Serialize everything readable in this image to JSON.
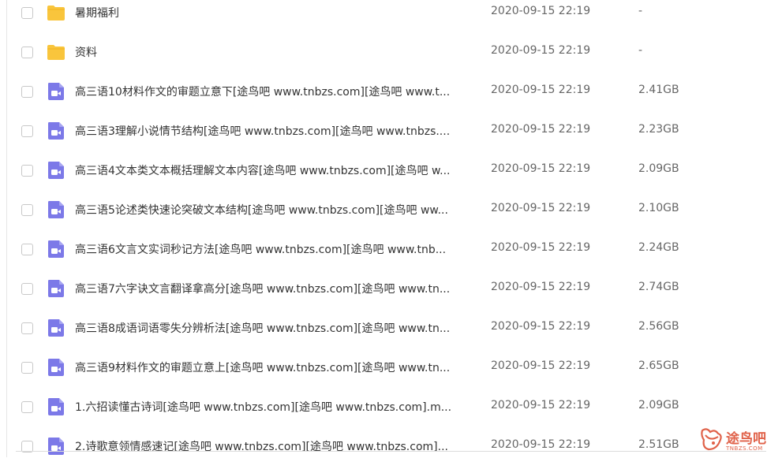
{
  "files": [
    {
      "name": "暑期福利",
      "date": "2020-09-15 22:19",
      "size": "-",
      "icon": "folder-icon",
      "type": "folder"
    },
    {
      "name": "资料",
      "date": "2020-09-15 22:19",
      "size": "-",
      "icon": "folder-icon",
      "type": "folder"
    },
    {
      "name": "高三语10材料作文的审题立意下[途鸟吧 www.tnbzs.com][途鸟吧 www.t...",
      "date": "2020-09-15 22:19",
      "size": "2.41GB",
      "icon": "video-file-icon",
      "type": "video"
    },
    {
      "name": "高三语3理解小说情节结构[途鸟吧 www.tnbzs.com][途鸟吧 www.tnbzs....",
      "date": "2020-09-15 22:19",
      "size": "2.23GB",
      "icon": "video-file-icon",
      "type": "video"
    },
    {
      "name": "高三语4文本类文本概括理解文本内容[途鸟吧 www.tnbzs.com][途鸟吧 w...",
      "date": "2020-09-15 22:19",
      "size": "2.09GB",
      "icon": "video-file-icon",
      "type": "video"
    },
    {
      "name": "高三语5论述类快速论突破文本结构[途鸟吧 www.tnbzs.com][途鸟吧 ww...",
      "date": "2020-09-15 22:19",
      "size": "2.10GB",
      "icon": "video-file-icon",
      "type": "video"
    },
    {
      "name": "高三语6文言文实词秒记方法[途鸟吧 www.tnbzs.com][途鸟吧 www.tnb...",
      "date": "2020-09-15 22:19",
      "size": "2.24GB",
      "icon": "video-file-icon",
      "type": "video"
    },
    {
      "name": "高三语7六字诀文言翻译拿高分[途鸟吧 www.tnbzs.com][途鸟吧 www.tn...",
      "date": "2020-09-15 22:19",
      "size": "2.74GB",
      "icon": "video-file-icon",
      "type": "video"
    },
    {
      "name": "高三语8成语词语零失分辨析法[途鸟吧 www.tnbzs.com][途鸟吧 www.tn...",
      "date": "2020-09-15 22:19",
      "size": "2.56GB",
      "icon": "video-file-icon",
      "type": "video"
    },
    {
      "name": "高三语9材料作文的审题立意上[途鸟吧 www.tnbzs.com][途鸟吧 www.tn...",
      "date": "2020-09-15 22:19",
      "size": "2.65GB",
      "icon": "video-file-icon",
      "type": "video"
    },
    {
      "name": "1.六招读懂古诗词[途鸟吧 www.tnbzs.com][途鸟吧 www.tnbzs.com].m...",
      "date": "2020-09-15 22:19",
      "size": "2.09GB",
      "icon": "video-file-icon",
      "type": "video"
    },
    {
      "name": "2.诗歌意领情感速记[途鸟吧 www.tnbzs.com][途鸟吧 www.tnbzs.com]...",
      "date": "2020-09-15 22:19",
      "size": "2.51GB",
      "icon": "video-file-icon",
      "type": "video"
    }
  ],
  "watermark": {
    "text": "途鸟吧",
    "subtext": "TNBZS.COM"
  },
  "colors": {
    "folder": "#f9c53c",
    "video": "#7c79e8",
    "watermark": "#e0624a"
  }
}
